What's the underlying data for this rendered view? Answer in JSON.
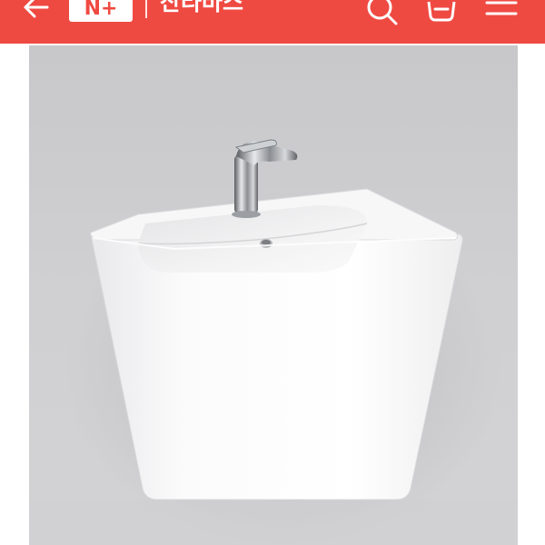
{
  "header": {
    "logo_text": "N+",
    "store_name": "산타바스",
    "background_color": "#ef4a42",
    "back_icon": "arrow-left-icon",
    "search_icon": "search-icon",
    "cart_icon": "basket-icon",
    "menu_icon": "hamburger-menu-icon"
  },
  "product": {
    "image": "wall-hung-white-ceramic-washbasin-with-chrome-faucet"
  }
}
